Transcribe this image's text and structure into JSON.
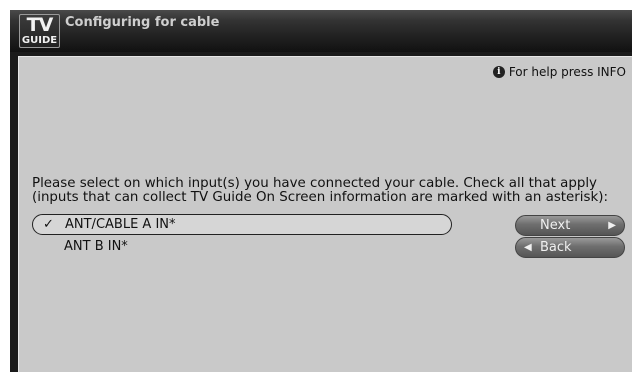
{
  "logo": {
    "top_text": "TV",
    "bottom_text": "GUIDE"
  },
  "header": {
    "title": "Configuring for cable"
  },
  "help": {
    "icon": "info-icon",
    "text": "For help press INFO"
  },
  "instructions": "Please select on which input(s) you have connected your cable.  Check all that apply (inputs that can collect TV Guide On Screen information are marked with an asterisk):",
  "options": [
    {
      "label": "ANT/CABLE A IN*",
      "checked": true,
      "check_mark": "✓",
      "focused": true
    },
    {
      "label": "ANT B IN*",
      "checked": false,
      "check_mark": "",
      "focused": false
    }
  ],
  "buttons": {
    "next": {
      "label": "Next",
      "arrow": "right-arrow-icon"
    },
    "back": {
      "label": "Back",
      "arrow": "left-arrow-icon"
    }
  }
}
